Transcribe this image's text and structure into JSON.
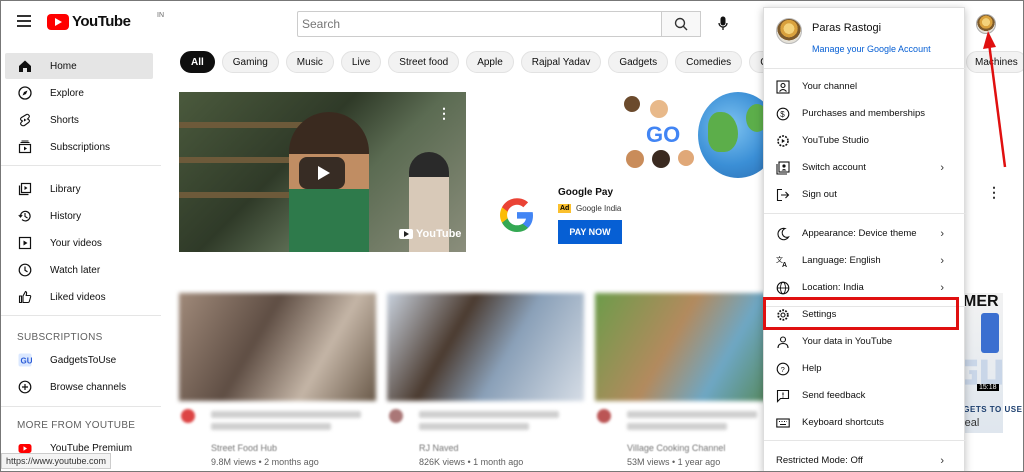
{
  "header": {
    "logo_text": "YouTube",
    "logo_country": "IN",
    "search_placeholder": "Search"
  },
  "sidebar": {
    "primary": [
      {
        "label": "Home",
        "icon": "home-icon"
      },
      {
        "label": "Explore",
        "icon": "compass-icon"
      },
      {
        "label": "Shorts",
        "icon": "shorts-icon"
      },
      {
        "label": "Subscriptions",
        "icon": "subscriptions-icon"
      }
    ],
    "library": [
      {
        "label": "Library",
        "icon": "library-icon"
      },
      {
        "label": "History",
        "icon": "history-icon"
      },
      {
        "label": "Your videos",
        "icon": "your-videos-icon"
      },
      {
        "label": "Watch later",
        "icon": "clock-icon"
      },
      {
        "label": "Liked videos",
        "icon": "thumbs-up-icon"
      }
    ],
    "subscriptions_heading": "SUBSCRIPTIONS",
    "subscriptions": [
      {
        "label": "GadgetsToUse",
        "icon": "channel-avatar-icon"
      },
      {
        "label": "Browse channels",
        "icon": "plus-circle-icon"
      }
    ],
    "more_heading": "MORE FROM YOUTUBE",
    "more": [
      {
        "label": "YouTube Premium",
        "icon": "youtube-icon"
      }
    ]
  },
  "chips": [
    "All",
    "Gaming",
    "Music",
    "Live",
    "Street food",
    "Apple",
    "Rajpal Yadav",
    "Gadgets",
    "Comedies",
    "Computers"
  ],
  "chip_right": "Machines",
  "video1": {
    "watermark": "YouTube"
  },
  "ad": {
    "title": "Google Pay",
    "badge": "Ad",
    "sponsor": "Google India",
    "cta": "PAY NOW",
    "banner_text": "GO"
  },
  "cards": [
    {
      "channel": "Street Food Hub",
      "views": "9.8M views • 2 months ago"
    },
    {
      "channel": "RJ Naved",
      "views": "826K views • 1 month ago"
    },
    {
      "channel": "Village Cooking Channel",
      "views": "53M views • 1 year ago"
    }
  ],
  "right_strip": {
    "text": "MER",
    "brand": "GADGETS TO USE",
    "duration": "15:18",
    "partial": "real"
  },
  "statusbar": {
    "url": "https://www.youtube.com"
  },
  "account_menu": {
    "name": "Paras Rastogi",
    "manage": "Manage your Google Account",
    "group1": [
      {
        "label": "Your channel",
        "icon": "person-icon",
        "chevron": false
      },
      {
        "label": "Purchases and memberships",
        "icon": "dollar-icon",
        "chevron": false
      },
      {
        "label": "YouTube Studio",
        "icon": "studio-gear-icon",
        "chevron": false
      },
      {
        "label": "Switch account",
        "icon": "switch-account-icon",
        "chevron": true
      },
      {
        "label": "Sign out",
        "icon": "sign-out-icon",
        "chevron": false
      }
    ],
    "group2": [
      {
        "label": "Appearance: Device theme",
        "icon": "moon-icon",
        "chevron": true
      },
      {
        "label": "Language: English",
        "icon": "translate-icon",
        "chevron": true
      },
      {
        "label": "Location: India",
        "icon": "globe-icon",
        "chevron": true
      }
    ],
    "group3": [
      {
        "label": "Settings",
        "icon": "gear-icon",
        "chevron": false
      },
      {
        "label": "Your data in YouTube",
        "icon": "shield-person-icon",
        "chevron": false
      },
      {
        "label": "Help",
        "icon": "help-icon",
        "chevron": false
      },
      {
        "label": "Send feedback",
        "icon": "feedback-icon",
        "chevron": false
      },
      {
        "label": "Keyboard shortcuts",
        "icon": "keyboard-icon",
        "chevron": false
      }
    ],
    "restricted": {
      "label": "Restricted Mode: Off",
      "chevron": true
    }
  },
  "colors": {
    "brand_red": "#ff0000",
    "link_blue": "#065fd4",
    "highlight_red": "#e01010"
  }
}
